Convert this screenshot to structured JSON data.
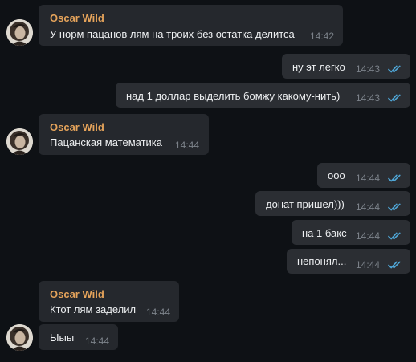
{
  "chat": {
    "sender_name": "Oscar Wild",
    "colors": {
      "background": "#0e1115",
      "incoming_bubble": "#25282d",
      "outgoing_bubble": "#2b2e33",
      "sender_name": "#e6a45b",
      "text": "#eef0f2",
      "time": "#7c828a",
      "read_check": "#4fa7d8"
    },
    "messages": [
      {
        "direction": "in",
        "sender": "Oscar Wild",
        "text": "У норм пацанов лям на троих без остатка делитса",
        "time": "14:42"
      },
      {
        "direction": "out",
        "text": "ну эт легко",
        "time": "14:43",
        "status": "read-double-check-icon"
      },
      {
        "direction": "out",
        "text": "над 1 доллар выделить бомжу какому-нить)",
        "time": "14:43",
        "status": "read-double-check-icon"
      },
      {
        "direction": "in",
        "sender": "Oscar Wild",
        "text": "Пацанская математика",
        "time": "14:44"
      },
      {
        "direction": "out",
        "text": "ооо",
        "time": "14:44",
        "status": "read-double-check-icon"
      },
      {
        "direction": "out",
        "text": "донат пришел)))",
        "time": "14:44",
        "status": "read-double-check-icon"
      },
      {
        "direction": "out",
        "text": "на 1 бакс",
        "time": "14:44",
        "status": "read-double-check-icon"
      },
      {
        "direction": "out",
        "text": "непонял...",
        "time": "14:44",
        "status": "read-double-check-icon"
      },
      {
        "direction": "in",
        "sender": "Oscar Wild",
        "text": "Ктот лям заделил",
        "time": "14:44"
      },
      {
        "direction": "in",
        "text": "Ыыы",
        "time": "14:44"
      }
    ]
  }
}
